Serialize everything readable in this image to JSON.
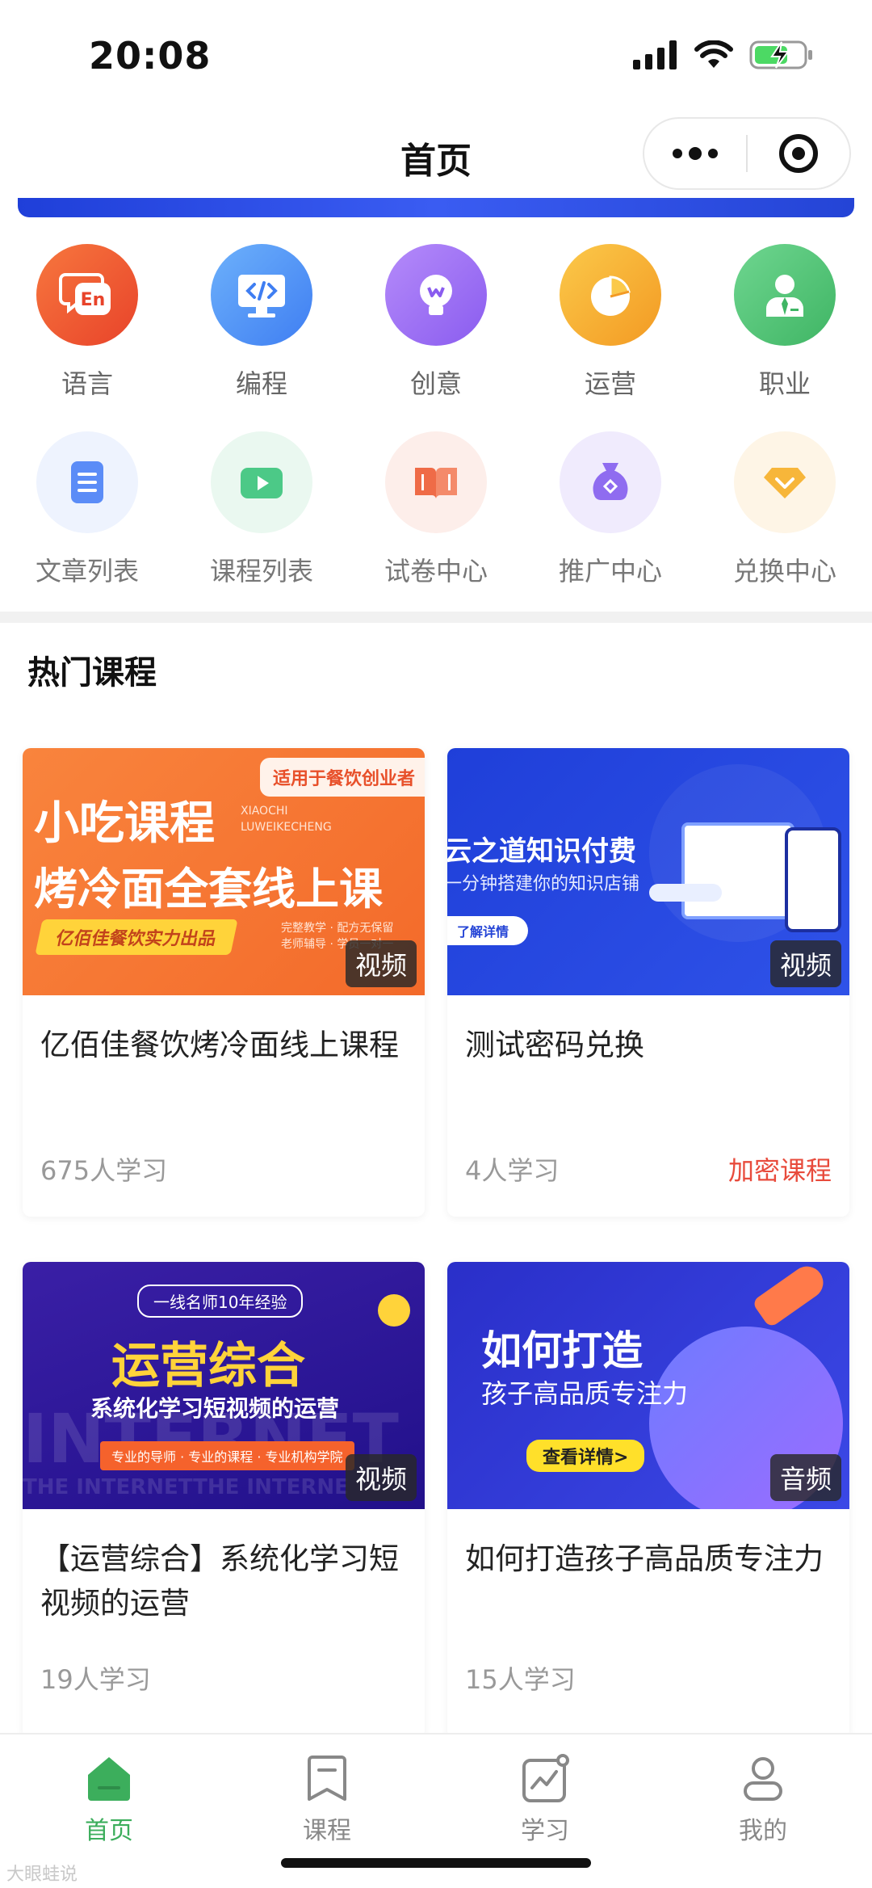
{
  "status_bar": {
    "time": "20:08"
  },
  "nav": {
    "title": "首页"
  },
  "categories_row1": [
    {
      "label": "语言",
      "icon": "language-icon",
      "color": "#ef5a2e"
    },
    {
      "label": "编程",
      "icon": "code-icon",
      "color": "#4a8cf5"
    },
    {
      "label": "创意",
      "icon": "bulb-icon",
      "color": "#9a6cf2"
    },
    {
      "label": "运营",
      "icon": "pie-chart-icon",
      "color": "#f7ad2f"
    },
    {
      "label": "职业",
      "icon": "person-icon",
      "color": "#4fc176"
    }
  ],
  "categories_row2": [
    {
      "label": "文章列表",
      "icon": "document-icon",
      "color": "#5b8cf7"
    },
    {
      "label": "课程列表",
      "icon": "play-icon",
      "color": "#4cc987"
    },
    {
      "label": "试卷中心",
      "icon": "book-icon",
      "color": "#ef6b47"
    },
    {
      "label": "推广中心",
      "icon": "money-bag-icon",
      "color": "#8f6cf0"
    },
    {
      "label": "兑换中心",
      "icon": "gem-icon",
      "color": "#f7b63a"
    }
  ],
  "section": {
    "title": "热门课程"
  },
  "courses": [
    {
      "title": "亿佰佳餐饮烤冷面线上课程",
      "learners": "675人学习",
      "type": "视频",
      "extra": "",
      "thumb": {
        "badge": "适用于餐饮创业者",
        "line1": "小吃课程",
        "pinyin1": "XIAOCHI",
        "pinyin2": "LUWEIKECHENG",
        "line2": "烤冷面全套线上课",
        "ribbon": "亿佰佳餐饮实力出品",
        "note1": "完整教学 · 配方无保留",
        "note2": "老师辅导 · 学员一对一"
      }
    },
    {
      "title": "测试密码兑换",
      "learners": "4人学习",
      "type": "视频",
      "extra": "加密课程",
      "thumb": {
        "line1": "云之道知识付费",
        "line2": "一分钟搭建你的知识店铺",
        "button": "了解详情"
      }
    },
    {
      "title": "【运营综合】系统化学习短视频的运营",
      "learners": "19人学习",
      "type": "视频",
      "extra": "",
      "thumb": {
        "badge": "一线名师10年经验",
        "line1": "运营综合",
        "line2": "系统化学习短视频的运营",
        "ribbon": "专业的导师 · 专业的课程 · 专业机构学院",
        "bg_word": "INTERNET",
        "bg_word2": "THE INTERNETTHE INTERNE"
      }
    },
    {
      "title": "如何打造孩子高品质专注力",
      "learners": "15人学习",
      "type": "音频",
      "extra": "",
      "thumb": {
        "line1": "如何打造",
        "line2": "孩子高品质专注力",
        "button": "查看详情>"
      }
    }
  ],
  "tabs": [
    {
      "label": "首页",
      "icon": "home-icon",
      "active": true
    },
    {
      "label": "课程",
      "icon": "bookmark-icon",
      "active": false
    },
    {
      "label": "学习",
      "icon": "study-chart-icon",
      "active": false
    },
    {
      "label": "我的",
      "icon": "profile-icon",
      "active": false
    }
  ],
  "watermark": "大眼蛙说",
  "colors": {
    "accent_green": "#3cae5c",
    "locked_red": "#e84b3c",
    "banner_blue": "#2444d6"
  }
}
